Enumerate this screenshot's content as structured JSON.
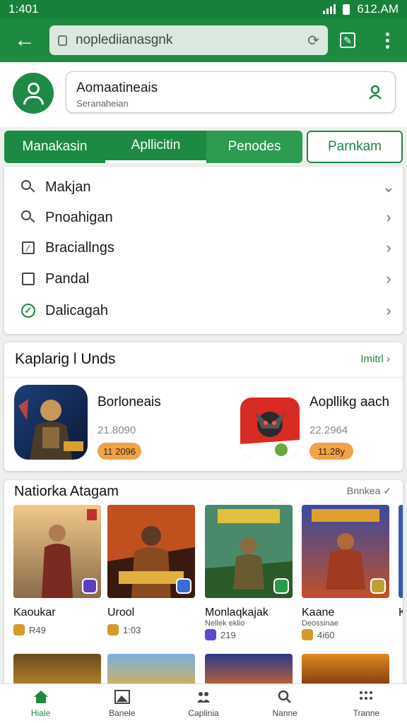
{
  "status": {
    "time": "1:401",
    "right_text": "612.AM"
  },
  "browser": {
    "url": "noplediianasgnk",
    "back_icon": "arrow-left-icon",
    "reload_icon": "reload-icon"
  },
  "search": {
    "title": "Aomaatineais",
    "subtitle": "Seranaheian"
  },
  "tabs": [
    "Manakasin",
    "Apllicitin",
    "Penodes",
    "Parnkam"
  ],
  "menu": [
    {
      "label": "Makjan",
      "icon": "search-box-icon",
      "chevron": "chevron-down-icon"
    },
    {
      "label": "Pnoahigan",
      "icon": "magnifier-icon",
      "chevron": "chevron-right-icon"
    },
    {
      "label": "Braciallngs",
      "icon": "edit-square-icon",
      "chevron": "chevron-right-icon"
    },
    {
      "label": "Pandal",
      "icon": "checkbox-icon",
      "chevron": "chevron-right-icon"
    },
    {
      "label": "Dalicagah",
      "icon": "check-circle-icon",
      "chevron": "chevron-right-icon"
    }
  ],
  "featured": {
    "title": "Kaplarig l Unds",
    "more": "Imitrl",
    "items": [
      {
        "name": "Borloneais",
        "sub": "21.8090",
        "price": "11 2096"
      },
      {
        "name": "Aopllikg aach",
        "sub": "22.2964",
        "price": "11.28y"
      }
    ]
  },
  "games": {
    "title": "Natiorka Atagam",
    "more": "Bnnkea",
    "items": [
      {
        "name": "Kaoukar",
        "sub": "",
        "meta": "R49"
      },
      {
        "name": "Urool",
        "sub": "",
        "meta": "1:03"
      },
      {
        "name": "Monlaqkajak",
        "sub": "Nellek eklio",
        "meta": "219"
      },
      {
        "name": "Kaane",
        "sub": "Deossinae",
        "meta": "4i60"
      },
      {
        "name": "K",
        "sub": "",
        "meta": ""
      }
    ]
  },
  "nav": [
    "Hiale",
    "Banele",
    "Caplinia",
    "Nanne",
    "Tranne"
  ],
  "colors": {
    "primary": "#1c8a42",
    "accent": "#f0a24a"
  }
}
